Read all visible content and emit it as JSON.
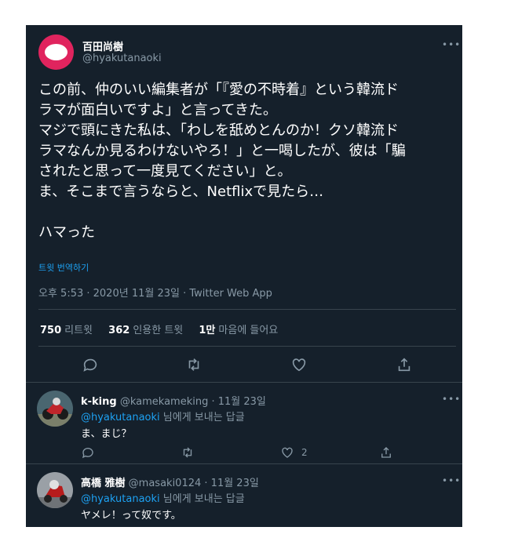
{
  "tweet": {
    "author_name": "百田尚樹",
    "author_handle": "@hyakutanaoki",
    "more": "•••",
    "lines": [
      "この前、仲のいい編集者が「『愛の不時着』という韓流ド",
      "ラマが面白いですよ」と言ってきた。",
      "マジで頭にきた私は、「わしを舐めとんのか！クソ韓流ド",
      "ラマなんか見るわけないやろ！」と一喝したが、彼は「騙",
      "されたと思って一度見てください」と。",
      "ま、そこまで言うならと、Netflixで見たら…",
      "",
      "ハマった"
    ],
    "translate": "트윗 번역하기",
    "timestamp": "오후 5:53 · 2020년 11월 23일 · Twitter Web App",
    "stats": {
      "retweets_num": "750",
      "retweets_label": "리트윗",
      "quotes_num": "362",
      "quotes_label": "인용한 트윗",
      "likes_num": "1만",
      "likes_label": "마음에 들어요"
    },
    "actions": [
      "reply-icon",
      "retweet-icon",
      "like-icon",
      "share-icon"
    ]
  },
  "replies": [
    {
      "name": "k-king",
      "handle": "@kamekameking",
      "date": "· 11월 23일",
      "to_user": "@hyakutanaoki",
      "to_suffix": " 님에게 보내는 답글",
      "text": "ま、まじ？",
      "like_count": "2",
      "more": "•••"
    },
    {
      "name": "高橋 雅樹",
      "handle": "@masaki0124",
      "date": "· 11월 23일",
      "to_user": "@hyakutanaoki",
      "to_suffix": " 님에게 보내는 답글",
      "text": "ヤメレ！って奴です。",
      "more": "•••"
    }
  ],
  "colors": {
    "background": "#15202b",
    "secondary_text": "#8899a6",
    "link": "#1da1f2",
    "avatar": "#e0245e",
    "divider": "#38444d"
  }
}
